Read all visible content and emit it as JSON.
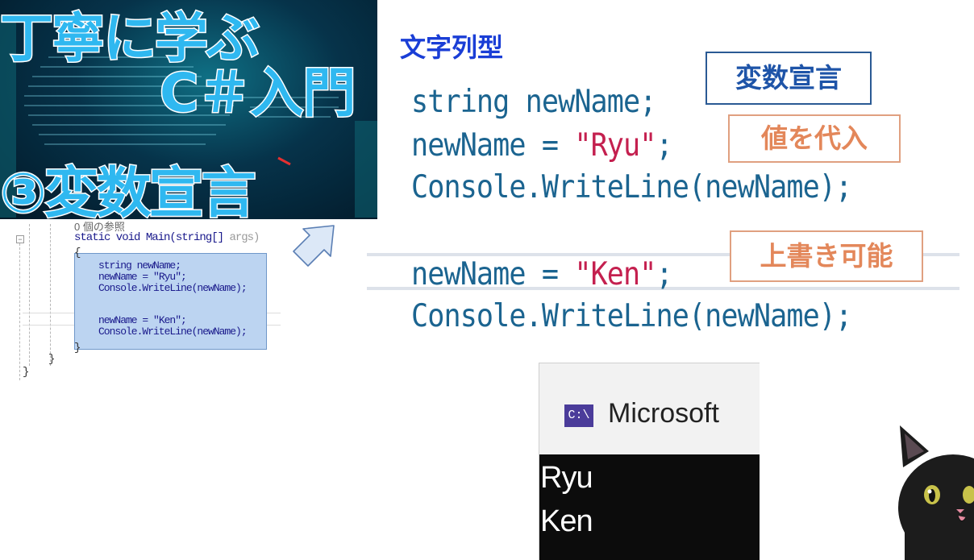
{
  "thumbnail": {
    "title_line1": "丁寧に学ぶ",
    "title_line2": "C＃入門",
    "episode": "③変数宣言",
    "background_color": "#06334a",
    "title_color": "#2fb8f0"
  },
  "ide": {
    "reference_count": "0 個の参照",
    "signature": "static void Main(string[]",
    "signature_muted": "args)",
    "lines": [
      "string newName;",
      "newName = \"Ryu\";",
      "Console.WriteLine(newName);",
      "newName = \"Ken\";",
      "Console.WriteLine(newName);"
    ],
    "open_brace": "{",
    "close_brace": "}",
    "collapse_glyph": "−"
  },
  "panel": {
    "title": "文字列型",
    "code": {
      "line1": "string newName;",
      "line2_prefix": "newName = ",
      "line2_string": "\"Ryu\"",
      "line2_suffix": ";",
      "line3": "Console.WriteLine(newName);",
      "line4_prefix": "newName = ",
      "line4_string": "\"Ken\"",
      "line4_suffix": ";",
      "line5": "Console.WriteLine(newName);"
    },
    "callouts": {
      "declaration": "変数宣言",
      "assignment": "値を代入",
      "overwrite": "上書き可能"
    },
    "colors": {
      "title": "#1a3ed6",
      "code": "#1b6490",
      "string": "#c4204f",
      "declaration_border": "#2a5a94",
      "callout_orange": "#e3875a"
    }
  },
  "console": {
    "icon_text": "C:\\",
    "title": "Microsoft",
    "output": [
      "Ryu",
      "Ken"
    ]
  },
  "icons": {
    "arrow": "arrow-up-right-icon",
    "mascot": "black-cat-mascot"
  }
}
